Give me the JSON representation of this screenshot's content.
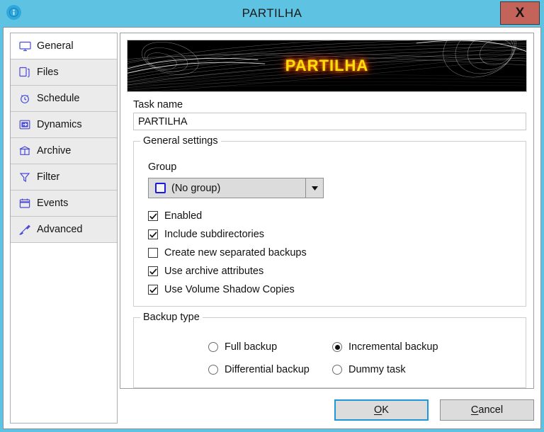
{
  "window": {
    "title": "PARTILHA",
    "app_icon": "info-badge-icon",
    "close_label": "X",
    "titlebar_color": "#5ec3e3",
    "close_button_color": "#c4635a"
  },
  "sidebar": {
    "items": [
      {
        "label": "General",
        "icon": "monitor-icon",
        "selected": true
      },
      {
        "label": "Files",
        "icon": "files-icon",
        "selected": false
      },
      {
        "label": "Schedule",
        "icon": "alarm-clock-icon",
        "selected": false
      },
      {
        "label": "Dynamics",
        "icon": "arrow-in-box-icon",
        "selected": false
      },
      {
        "label": "Archive",
        "icon": "archive-box-icon",
        "selected": false
      },
      {
        "label": "Filter",
        "icon": "funnel-icon",
        "selected": false
      },
      {
        "label": "Events",
        "icon": "calendar-icon",
        "selected": false
      },
      {
        "label": "Advanced",
        "icon": "awl-tool-icon",
        "selected": false
      }
    ]
  },
  "banner": {
    "text": "PARTILHA",
    "text_color": "#ffdf0a",
    "glow_color": "#ff5000",
    "background_color": "#000000"
  },
  "task_name": {
    "label": "Task name",
    "value": "PARTILHA",
    "placeholder": "Task name"
  },
  "general_settings": {
    "title": "General settings",
    "group": {
      "label": "Group",
      "selected": "(No group)",
      "icon": "group-square-icon",
      "arrow_icon": "chevron-down-icon"
    },
    "checkboxes": [
      {
        "label": "Enabled",
        "checked": true
      },
      {
        "label": "Include subdirectories",
        "checked": true
      },
      {
        "label": "Create new separated backups",
        "checked": false
      },
      {
        "label": "Use archive attributes",
        "checked": true
      },
      {
        "label": "Use Volume Shadow Copies",
        "checked": true
      }
    ]
  },
  "backup_type": {
    "title": "Backup type",
    "options": [
      {
        "label": "Full backup",
        "selected": false
      },
      {
        "label": "Incremental backup",
        "selected": true
      },
      {
        "label": "Differential backup",
        "selected": false
      },
      {
        "label": "Dummy task",
        "selected": false
      }
    ]
  },
  "footer": {
    "ok_label": "OK",
    "ok_accel": "O",
    "cancel_label": "Cancel",
    "cancel_accel": "C"
  }
}
